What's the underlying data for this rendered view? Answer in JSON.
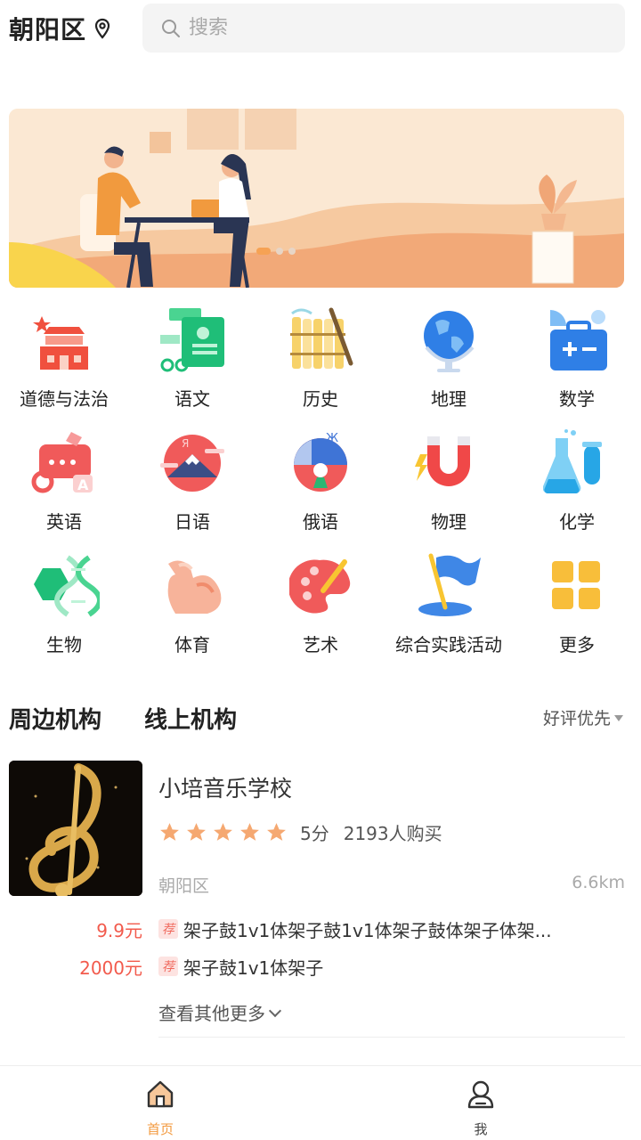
{
  "header": {
    "district": "朝阳区",
    "search_placeholder": "搜索"
  },
  "banner": {
    "slide_count": 3,
    "active_slide": 1
  },
  "categories": [
    {
      "label": "道德与法治",
      "icon": "palace-icon"
    },
    {
      "label": "语文",
      "icon": "scroll-icon"
    },
    {
      "label": "历史",
      "icon": "bamboo-slip-icon"
    },
    {
      "label": "地理",
      "icon": "globe-icon"
    },
    {
      "label": "数学",
      "icon": "math-kit-icon"
    },
    {
      "label": "英语",
      "icon": "english-chat-icon"
    },
    {
      "label": "日语",
      "icon": "mount-fuji-icon"
    },
    {
      "label": "俄语",
      "icon": "russian-icon"
    },
    {
      "label": "物理",
      "icon": "magnet-icon"
    },
    {
      "label": "化学",
      "icon": "flask-icon"
    },
    {
      "label": "生物",
      "icon": "dna-icon"
    },
    {
      "label": "体育",
      "icon": "muscle-arm-icon"
    },
    {
      "label": "艺术",
      "icon": "palette-icon"
    },
    {
      "label": "综合实践活动",
      "icon": "flag-icon"
    },
    {
      "label": "更多",
      "icon": "more-grid-icon"
    }
  ],
  "tabs": {
    "items": [
      {
        "label": "周边机构",
        "active": true
      },
      {
        "label": "线上机构",
        "active": false
      }
    ],
    "sort_label": "好评优先"
  },
  "listing": {
    "name": "小培音乐学校",
    "rating_stars": 5,
    "score": "5分",
    "buyers": "2193人购买",
    "area": "朝阳区",
    "distance": "6.6km",
    "offers": [
      {
        "price": "9.9元",
        "tag": "荐",
        "title": "架子鼓1v1体架子鼓1v1体架子鼓体架子体架..."
      },
      {
        "price": "2000元",
        "tag": "荐",
        "title": "架子鼓1v1体架子"
      }
    ],
    "more_label": "查看其他更多"
  },
  "bottom_nav": [
    {
      "label": "首页",
      "icon": "home-icon",
      "active": true
    },
    {
      "label": "我",
      "icon": "user-icon",
      "active": false
    }
  ],
  "colors": {
    "accent": "#f39a3f",
    "price": "#f25a4c",
    "star": "#f5a871",
    "tab_underline": "#fbd3b6"
  }
}
